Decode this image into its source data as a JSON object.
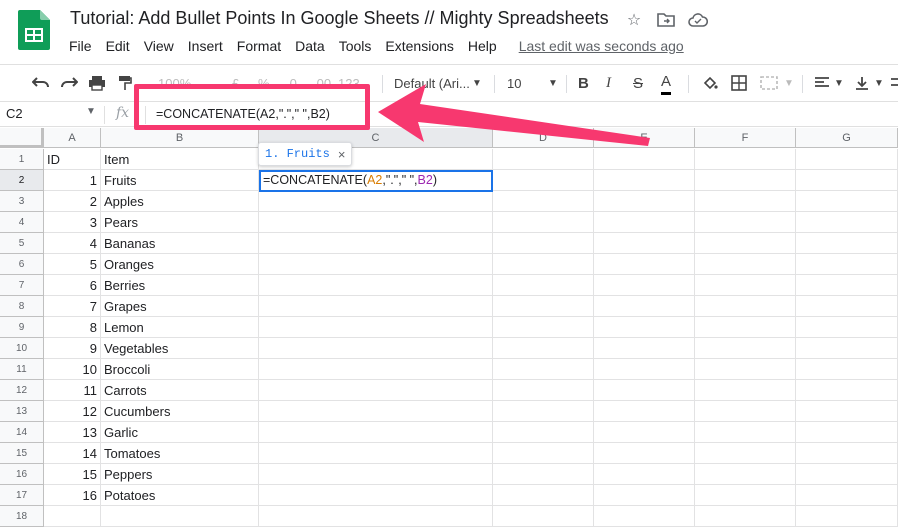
{
  "app": {
    "doc_title": "Tutorial: Add Bullet Points In Google Sheets // Mighty Spreadsheets",
    "title_icons": [
      "star-icon",
      "move-folder-icon",
      "cloud-saved-icon"
    ],
    "brand_color": "#0f9d58"
  },
  "menu": {
    "items": [
      "File",
      "Edit",
      "View",
      "Insert",
      "Format",
      "Data",
      "Tools",
      "Extensions",
      "Help"
    ],
    "last_edit": "Last edit was seconds ago"
  },
  "toolbar": {
    "zoom": "100%",
    "currency": "£",
    "percent": "%",
    "decrease_decimals": ".0",
    "increase_decimals": ".00",
    "more_formats": "123",
    "font": "Default (Ari...",
    "font_size": "10",
    "bold": "B",
    "italic": "I",
    "strikethrough": "S",
    "text_color": "A"
  },
  "formula_bar": {
    "cell_ref": "C2",
    "fx": "fx",
    "formula": "=CONCATENATE(A2,\".\",\" \",B2)"
  },
  "grid": {
    "columns": [
      "A",
      "B",
      "C",
      "D",
      "E",
      "F",
      "G"
    ],
    "active_column": "C",
    "active_row": "2",
    "rows": [
      {
        "num": "1",
        "a": "ID",
        "b": "Item"
      },
      {
        "num": "2",
        "a": "1",
        "b": "Fruits"
      },
      {
        "num": "3",
        "a": "2",
        "b": "Apples"
      },
      {
        "num": "4",
        "a": "3",
        "b": "Pears"
      },
      {
        "num": "5",
        "a": "4",
        "b": "Bananas"
      },
      {
        "num": "6",
        "a": "5",
        "b": "Oranges"
      },
      {
        "num": "7",
        "a": "6",
        "b": "Berries"
      },
      {
        "num": "8",
        "a": "7",
        "b": "Grapes"
      },
      {
        "num": "9",
        "a": "8",
        "b": "Lemon"
      },
      {
        "num": "10",
        "a": "9",
        "b": "Vegetables"
      },
      {
        "num": "11",
        "a": "10",
        "b": "Broccoli"
      },
      {
        "num": "12",
        "a": "11",
        "b": "Carrots"
      },
      {
        "num": "13",
        "a": "12",
        "b": "Cucumbers"
      },
      {
        "num": "14",
        "a": "13",
        "b": "Garlic"
      },
      {
        "num": "15",
        "a": "14",
        "b": "Tomatoes"
      },
      {
        "num": "16",
        "a": "15",
        "b": "Peppers"
      },
      {
        "num": "17",
        "a": "16",
        "b": "Potatoes"
      },
      {
        "num": "18",
        "a": "",
        "b": ""
      }
    ],
    "editor": {
      "fn": "=CONCATENATE(",
      "ref_a": "A2",
      "sep1": ",",
      "str1": "\".\"",
      "sep2": ",",
      "str2": "\" \"",
      "sep3": ",",
      "ref_b": "B2",
      "close": ")"
    },
    "preview": {
      "text": "1. Fruits",
      "close": "×"
    }
  },
  "annotation": {
    "highlight_color": "#f7386f"
  }
}
